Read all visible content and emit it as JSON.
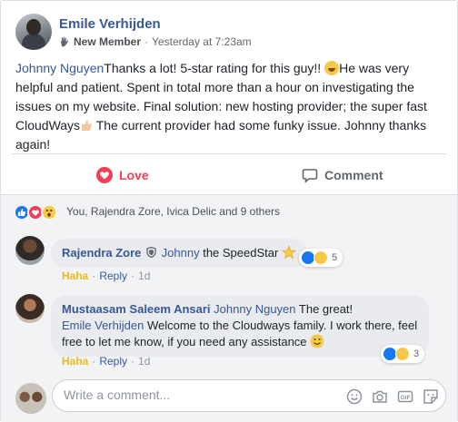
{
  "post": {
    "author": "Emile Verhijden",
    "badge": "New Member",
    "separator": "·",
    "timestamp": "Yesterday at 7:23am",
    "text": {
      "mention": "Johnny Nguyen",
      "part1": "Thanks a lot! 5-star rating for this guy!! ",
      "part2": "He was very helpful and patient. Spent in total more than a hour on investigating the issues on my website. Final solution: new hosting provider; the super fast CloudWays",
      "part3": " The current provider had some funky issue. Johnny thanks again!"
    }
  },
  "actions": {
    "love_label": "Love",
    "comment_label": "Comment"
  },
  "reactions": {
    "summary": "You, Rajendra Zore, Ivica Delic and 9 others"
  },
  "comments": [
    {
      "author": "Rajendra Zore",
      "mention": "Johnny",
      "text": " the SpeedStar ",
      "reaction_count": "5",
      "reaction_label": "Haha",
      "reply_label": "Reply",
      "time": "1d"
    },
    {
      "author": "Mustaasam Saleem Ansari",
      "mention": "Johnny Nguyen",
      "text": " The great!",
      "mention2": "Emile Verhijden",
      "text2": " Welcome to the Cloudways family. I work there, feel free to let me know, if you need any assistance ",
      "reaction_count": "3",
      "reaction_label": "Haha",
      "reply_label": "Reply",
      "time": "1d"
    }
  ],
  "composer": {
    "placeholder": "Write a comment..."
  },
  "colors": {
    "link": "#385898",
    "love": "#f33e58",
    "haha": "#f0ba15",
    "like": "#1877f2"
  }
}
